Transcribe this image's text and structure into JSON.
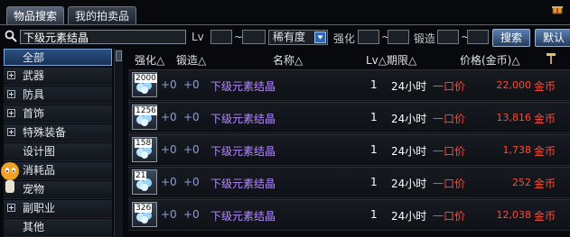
{
  "tabs": [
    {
      "label": "物品搜索",
      "active": true
    },
    {
      "label": "我的拍卖品",
      "active": false
    }
  ],
  "search": {
    "query": "下级元素结晶",
    "lv_label": "Lv",
    "lv_sep": "~",
    "rarity_selected": "稀有度",
    "enhance_label": "强化",
    "enhance_sep": "~",
    "forge_label": "锻造",
    "forge_sep": "~",
    "search_button": "搜索",
    "default_button": "默认"
  },
  "categories": [
    {
      "label": "全部",
      "expandable": false,
      "selected": true
    },
    {
      "label": "武器",
      "expandable": true,
      "selected": false
    },
    {
      "label": "防具",
      "expandable": true,
      "selected": false
    },
    {
      "label": "首饰",
      "expandable": true,
      "selected": false
    },
    {
      "label": "特殊装备",
      "expandable": true,
      "selected": false
    },
    {
      "label": "设计图",
      "expandable": false,
      "selected": false
    },
    {
      "label": "消耗品",
      "expandable": false,
      "selected": false
    },
    {
      "label": "宠物",
      "expandable": false,
      "selected": false
    },
    {
      "label": "副职业",
      "expandable": true,
      "selected": false
    },
    {
      "label": "其他",
      "expandable": false,
      "selected": false
    }
  ],
  "columns": {
    "enhance": "强化△",
    "forge": "锻造△",
    "name": "名称△",
    "lv_period": "Lv△期限△",
    "price": "价格(金币)△"
  },
  "rows": [
    {
      "qty": "2000",
      "enhance": "+0",
      "forge": "+0",
      "name": "下级元素结晶",
      "lv": "1",
      "period": "24小时",
      "price_type": "一口价",
      "price": "22,000",
      "currency": "金币"
    },
    {
      "qty": "1256",
      "enhance": "+0",
      "forge": "+0",
      "name": "下级元素结晶",
      "lv": "1",
      "period": "24小时",
      "price_type": "一口价",
      "price": "13,816",
      "currency": "金币"
    },
    {
      "qty": "158",
      "enhance": "+0",
      "forge": "+0",
      "name": "下级元素结晶",
      "lv": "1",
      "period": "24小时",
      "price_type": "一口价",
      "price": "1,738",
      "currency": "金币"
    },
    {
      "qty": "21",
      "enhance": "+0",
      "forge": "+0",
      "name": "下级元素结晶",
      "lv": "1",
      "period": "24小时",
      "price_type": "一口价",
      "price": "252",
      "currency": "金币"
    },
    {
      "qty": "326",
      "enhance": "+0",
      "forge": "+0",
      "name": "下级元素结晶",
      "lv": "1",
      "period": "24小时",
      "price_type": "一口价",
      "price": "12,038",
      "currency": "金币"
    }
  ],
  "icons": {
    "search": "search-icon",
    "dropdown": "chevron-down-icon",
    "hammer": "hammer-icon",
    "item": "crystal-icon"
  },
  "colors": {
    "item_name": "#b38aff",
    "price": "#ff4a3a",
    "accent": "#2a67b6"
  }
}
